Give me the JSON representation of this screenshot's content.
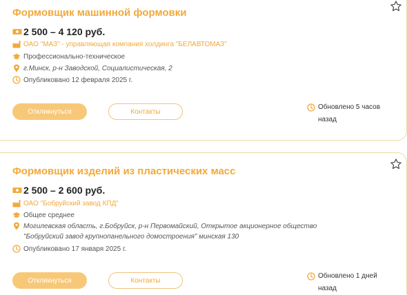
{
  "vacancies": [
    {
      "title": "Формовщик машинной формовки",
      "salary": "2 500 – 4 120 руб.",
      "company": "ОАО \"МАЗ\" - управляющая компания холдинга \"БЕЛАВТОМАЗ\"",
      "education": "Профессионально-техническое",
      "address": "г.Минск, р-н Заводской, Социалистическая, 2",
      "published": "Опубликовано 12 февраля 2025 г.",
      "apply_label": "Откликнуться",
      "contacts_label": "Контакты",
      "updated": "Обновлено 5 часов назад"
    },
    {
      "title": "Формовщик изделий из пластических масс",
      "salary": "2 500 – 2 600 руб.",
      "company": "ОАО \"Бобруйский завод КПД\"",
      "education": "Общее среднее",
      "address_line1": "Могилевская область, г.Бобруйск, р-н Первомайский, Открытое акционерное общество",
      "address_line2": "\"Бобруйский завод крупнопанельного домостроения\" минская 130",
      "published": "Опубликовано 17 января 2025 г.",
      "apply_label": "Откликнуться",
      "contacts_label": "Контакты",
      "updated": "Обновлено 1 дней назад"
    }
  ],
  "icons": {
    "salary": "money-icon",
    "company": "factory-icon",
    "education": "graduation-cap-icon",
    "address": "location-pin-icon",
    "published": "clock-icon",
    "updated": "clock-icon",
    "favorite": "star-outline-icon"
  },
  "colors": {
    "accent": "#f2a93b",
    "button_fill": "#f8c879",
    "border": "#f1d9a6"
  }
}
